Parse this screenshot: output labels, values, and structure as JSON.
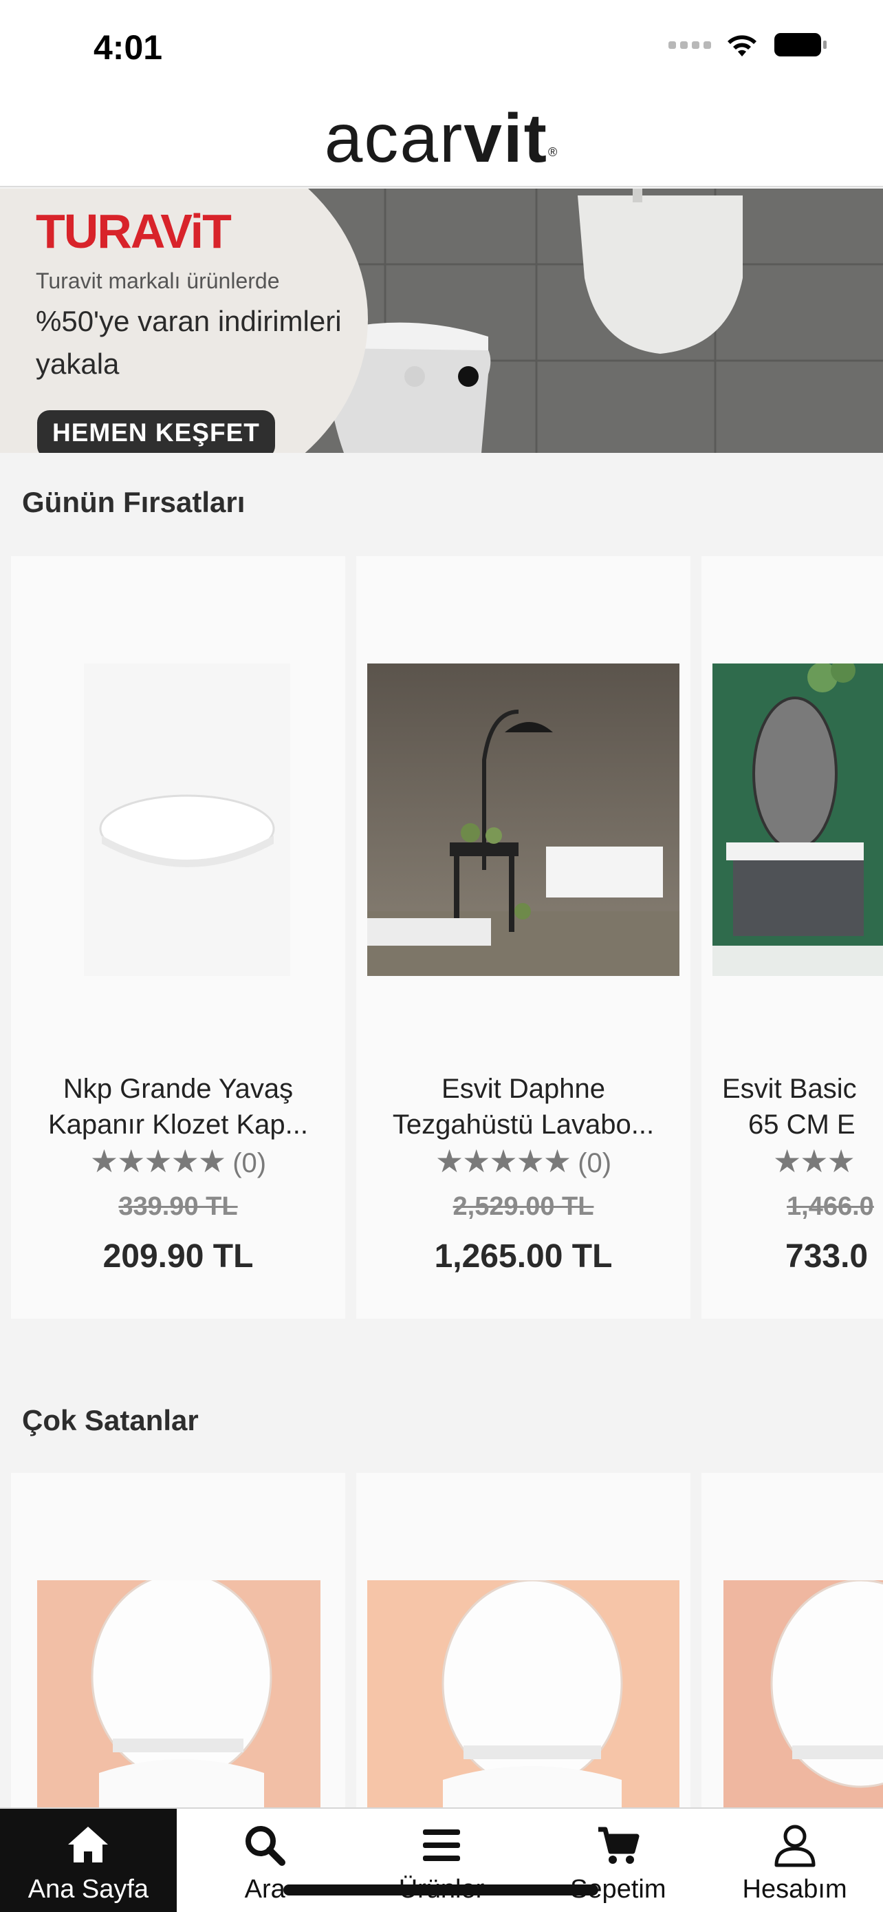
{
  "status": {
    "time": "4:01"
  },
  "header": {
    "logo_light": "acar",
    "logo_bold": "vit",
    "logo_mark": "®"
  },
  "banner": {
    "brand": "TURAViT",
    "subtitle": "Turavit markalı ürünlerde",
    "headline": "%50'ye varan indirimleri yakala",
    "cta": "HEMEN KEŞFET"
  },
  "sections": {
    "deals_title": "Günün Fırsatları",
    "bestsellers_title": "Çok Satanlar"
  },
  "deals": [
    {
      "title_line1": "Nkp Grande Yavaş",
      "title_line2": "Kapanır Klozet Kap...",
      "stars": "★★★★★",
      "reviews": "(0)",
      "old_price": "339.90 TL",
      "price": "209.90 TL"
    },
    {
      "title_line1": "Esvit Daphne",
      "title_line2": "Tezgahüstü Lavabo...",
      "stars": "★★★★★",
      "reviews": "(0)",
      "old_price": "2,529.00 TL",
      "price": "1,265.00 TL"
    },
    {
      "title_line1": "Esvit Basic",
      "title_line2": "65 CM E",
      "stars": "★★★",
      "reviews": "",
      "old_price": "1,466.0",
      "price": "733.0"
    }
  ],
  "nav": {
    "home": "Ana Sayfa",
    "search": "Ara",
    "products": "Ürünler",
    "cart": "Sepetim",
    "account": "Hesabım"
  },
  "colors": {
    "brand_red": "#d8232a",
    "accent_dark": "#111111"
  }
}
